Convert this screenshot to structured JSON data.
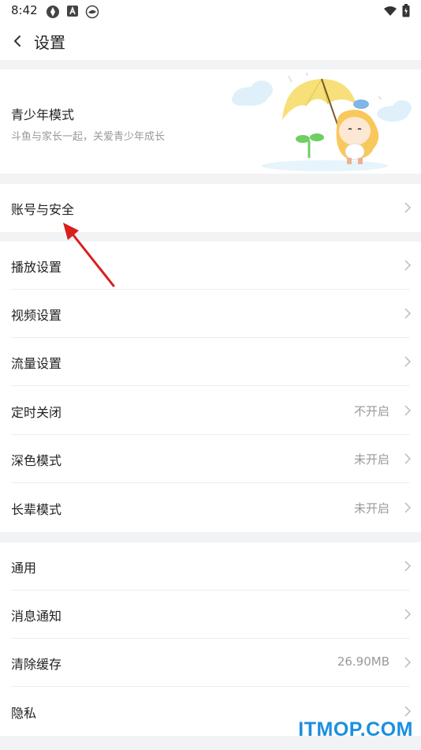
{
  "status_bar": {
    "time": "8:42",
    "left_icons": [
      "app-icon",
      "a-icon",
      "fish-icon"
    ],
    "right_icons": [
      "wifi-icon",
      "battery-icon"
    ]
  },
  "nav": {
    "title": "设置"
  },
  "teen_mode": {
    "title": "青少年模式",
    "subtitle": "斗鱼与家长一起，关爱青少年成长"
  },
  "account": {
    "label": "账号与安全"
  },
  "playback_group": [
    {
      "label": "播放设置",
      "value": ""
    },
    {
      "label": "视频设置",
      "value": ""
    },
    {
      "label": "流量设置",
      "value": ""
    },
    {
      "label": "定时关闭",
      "value": "不开启"
    },
    {
      "label": "深色模式",
      "value": "未开启"
    },
    {
      "label": "长辈模式",
      "value": "未开启"
    }
  ],
  "general_group": [
    {
      "label": "通用",
      "value": ""
    },
    {
      "label": "消息通知",
      "value": ""
    },
    {
      "label": "清除缓存",
      "value": "26.90MB"
    },
    {
      "label": "隐私",
      "value": ""
    }
  ],
  "watermark": "ITMOP.COM",
  "colors": {
    "background": "#f2f3f5",
    "card": "#ffffff",
    "annotation_arrow": "#d91e1e",
    "watermark": "#1a8fe0"
  }
}
